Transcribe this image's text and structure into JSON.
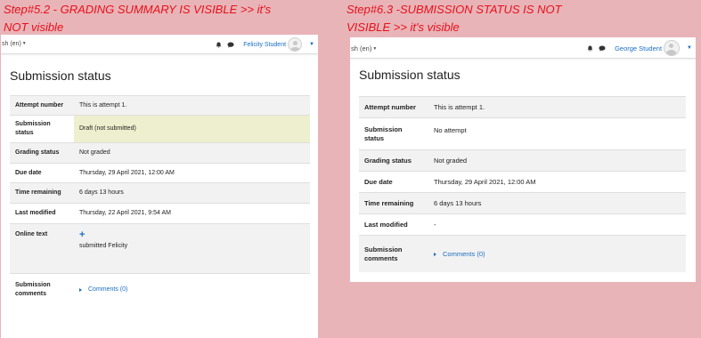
{
  "captions": {
    "left_line1": "Step#5.2 - GRADING SUMMARY IS VISIBLE >> it's",
    "left_line2": "NOT visible",
    "right_line1": "Step#6.3 -SUBMISSION STATUS IS NOT",
    "right_line2": "VISIBLE >> it's visible"
  },
  "left": {
    "navbar": {
      "language": "sh (en)",
      "user_name": "Felicity Student"
    },
    "title": "Submission status",
    "rows": {
      "attempt": {
        "label": "Attempt number",
        "value": "This is attempt 1."
      },
      "submission_status": {
        "label_line1": "Submission",
        "label_line2": "status",
        "value": "Draft (not submitted)"
      },
      "grading": {
        "label": "Grading status",
        "value": "Not graded"
      },
      "due": {
        "label": "Due date",
        "value": "Thursday, 29 April 2021, 12:00 AM"
      },
      "remaining": {
        "label": "Time remaining",
        "value": "6 days 13 hours"
      },
      "modified": {
        "label": "Last modified",
        "value": "Thursday, 22 April 2021, 9:54 AM"
      },
      "online_text": {
        "label": "Online text",
        "plus": "+",
        "value": "submitted Felicity"
      },
      "comments": {
        "label_line1": "Submission",
        "label_line2": "comments",
        "value": "Comments (0)"
      }
    }
  },
  "right": {
    "navbar": {
      "language": "sh (en)",
      "user_name": "George Student"
    },
    "title": "Submission status",
    "rows": {
      "attempt": {
        "label": "Attempt number",
        "value": "This is attempt 1."
      },
      "submission_status": {
        "label_line1": "Submission",
        "label_line2": "status",
        "value": "No attempt"
      },
      "grading": {
        "label": "Grading status",
        "value": "Not graded"
      },
      "due": {
        "label": "Due date",
        "value": "Thursday, 29 April 2021, 12:00 AM"
      },
      "remaining": {
        "label": "Time remaining",
        "value": "6 days 13 hours"
      },
      "modified": {
        "label": "Last modified",
        "value": "-"
      },
      "comments": {
        "label_line1": "Submission",
        "label_line2": "comments",
        "value": "Comments (0)"
      }
    }
  },
  "colors": {
    "background": "#e8b4b8",
    "caption_red": "#e8101a",
    "link_blue": "#1a6ec2",
    "draft_highlight": "#eeefce",
    "row_stripe": "#f2f2f2"
  },
  "icons": [
    "bell-icon",
    "chat-icon",
    "avatar-icon",
    "caret-down-icon",
    "plus-icon",
    "triangle-right-icon"
  ]
}
